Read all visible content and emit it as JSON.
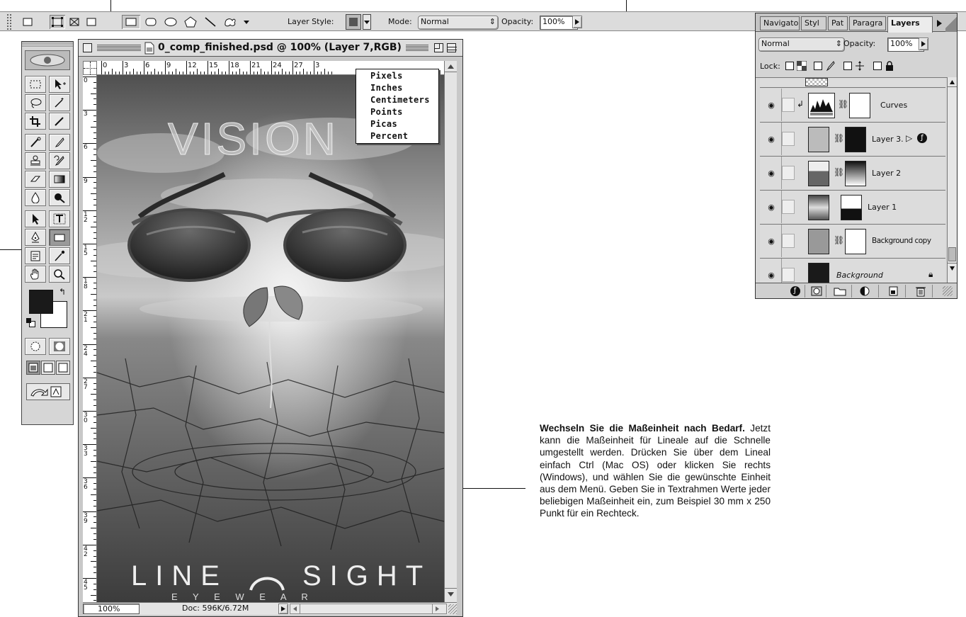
{
  "options_bar": {
    "layer_style_label": "Layer Style:",
    "mode_label": "Mode:",
    "mode_value": "Normal",
    "opacity_label": "Opacity:",
    "opacity_value": "100%"
  },
  "document": {
    "title": "0_comp_finished.psd @ 100% (Layer 7,RGB)",
    "zoom": "100%",
    "doc_size": "Doc: 596K/6.72M",
    "ruler_h_ticks": [
      "0",
      "3",
      "6",
      "9",
      "12",
      "15",
      "18",
      "21",
      "24",
      "27",
      "3"
    ],
    "ruler_v_ticks": [
      "0",
      "3",
      "6",
      "9",
      "12",
      "15",
      "18",
      "21",
      "24",
      "27",
      "30",
      "33",
      "36",
      "39",
      "42",
      "45"
    ],
    "artwork": {
      "headline": "VISION",
      "brand": "LINE",
      "brand2": "SIGHT",
      "tagline": "E Y E W E A R"
    }
  },
  "units_menu": {
    "items": [
      "Pixels",
      "Inches",
      "Centimeters",
      "Points",
      "Picas",
      "Percent"
    ]
  },
  "layers_palette": {
    "tabs": [
      "Navigato",
      "Styl",
      "Pat",
      "Paragra",
      "Layers"
    ],
    "blend_mode": "Normal",
    "opacity_label": "Opacity:",
    "opacity_value": "100%",
    "lock_label": "Lock:",
    "layers": [
      {
        "name": "Curves"
      },
      {
        "name": "Layer 3."
      },
      {
        "name": "Layer 2"
      },
      {
        "name": "Layer 1"
      },
      {
        "name": "Background copy"
      },
      {
        "name": "Background"
      }
    ]
  },
  "caption": {
    "heading": "Wechseln Sie die Maßeinheit nach Bedarf.",
    "body": "Jetzt kann die Maßeinheit für Lineale auf die Schnelle umgestellt werden. Drücken Sie über dem Lineal einfach Ctrl (Mac OS) oder klicken Sie rechts (Windows), und wählen Sie die gewünschte Einheit aus dem Menü. Geben Sie in Textrahmen Werte jeder beliebigen Maßeinheit ein, zum Beispiel 30 mm x 250 Punkt für ein Rechteck."
  },
  "colors": {
    "chrome": "#dcdcdc",
    "foreground_swatch": "#1a1a1a",
    "background_swatch": "#ffffff"
  }
}
